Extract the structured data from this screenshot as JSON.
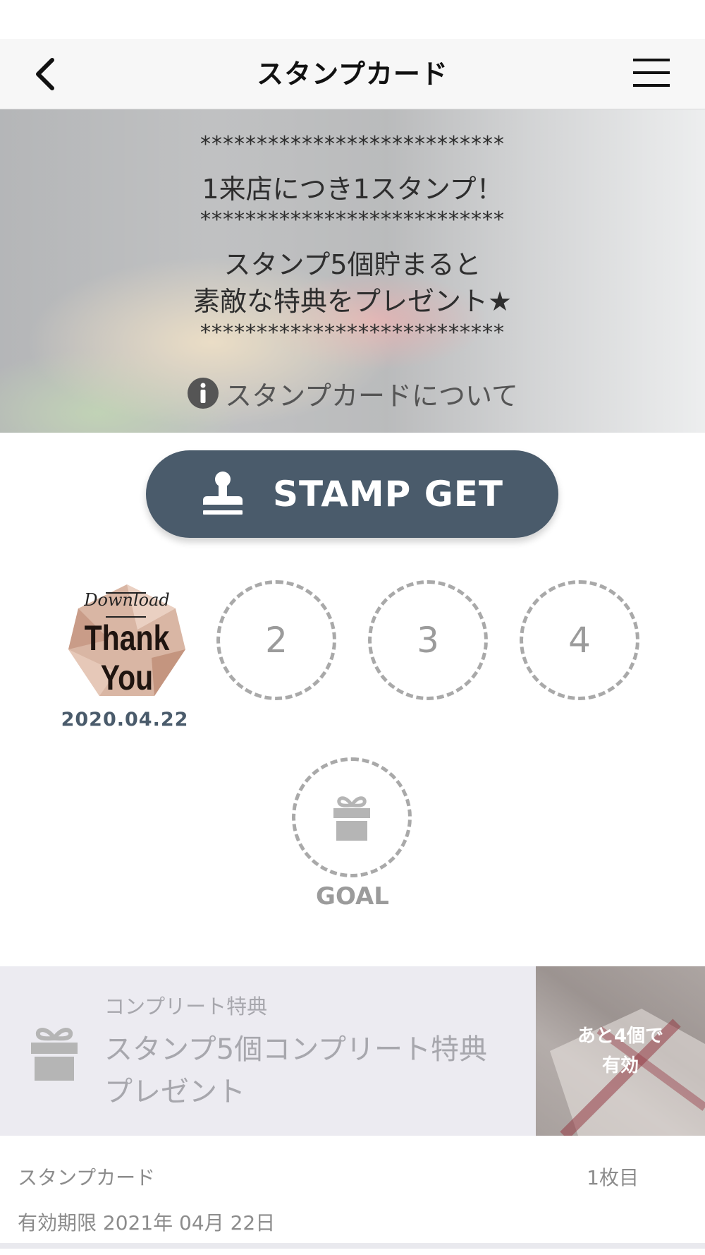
{
  "header": {
    "title": "スタンプカード",
    "back_icon": "chevron-left-icon",
    "menu_icon": "hamburger-menu-icon"
  },
  "hero": {
    "stars_1": "***************************",
    "line_1": "1来店につき1スタンプ！",
    "stars_2": "***************************",
    "line_2": "スタンプ5個貯まると",
    "line_3": "素敵な特典をプレゼント★",
    "stars_3": "***************************",
    "about_label": "スタンプカードについて",
    "about_icon": "info-icon"
  },
  "stamp_button": {
    "label": "STAMP GET",
    "icon": "stamp-icon",
    "color": "#4a5b6b"
  },
  "stamps": {
    "collected": [
      {
        "image_text_top": "Download",
        "image_text_main_1": "Thank",
        "image_text_main_2": "You",
        "date": "2020.04.22"
      }
    ],
    "slots": [
      "2",
      "3",
      "4"
    ],
    "goal_label": "GOAL",
    "goal_icon": "gift-icon"
  },
  "bonus": {
    "category": "コンプリート特典",
    "title_line_1": "スタンプ5個コンプリート特典",
    "title_line_2": "プレゼント",
    "remaining_line_1": "あと4個で",
    "remaining_line_2": "有効",
    "icon": "gift-icon"
  },
  "footer": {
    "label": "スタンプカード",
    "count": "1枚目",
    "expiry": "有効期限 2021年 04月 22日"
  }
}
